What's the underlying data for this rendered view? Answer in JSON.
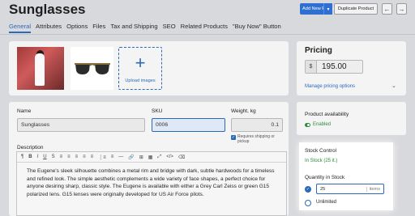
{
  "header": {
    "title": "Sunglasses",
    "add_new_label": "Add New Product",
    "duplicate_label": "Duplicate Product",
    "prev_icon": "arrow-left-icon",
    "next_icon": "arrow-right-icon"
  },
  "tabs": [
    {
      "label": "General",
      "active": true
    },
    {
      "label": "Attributes"
    },
    {
      "label": "Options"
    },
    {
      "label": "Files"
    },
    {
      "label": "Tax and Shipping"
    },
    {
      "label": "SEO"
    },
    {
      "label": "Related Products"
    },
    {
      "label": "\"Buy Now\" Button"
    }
  ],
  "images": {
    "upload_label": "Upload images"
  },
  "fields": {
    "name_label": "Name",
    "name_value": "Sunglasses",
    "sku_label": "SKU",
    "sku_value": "0006",
    "weight_label": "Weight, kg",
    "weight_value": "0.1",
    "shipping_note": "Requires shipping or pickup",
    "description_label": "Description",
    "description_text": "The Eugene's sleek silhouette combines a metal rim and bridge with dark, subtle hardwoods for a timeless and refined look. The simple aesthetic complements a wide variety of face shapes, a perfect choice for anyone desiring sharp, classic style. The Eugene is available with either a Grey Carl Zeiss or green G15 polarized lens. G15 lenses were originally developed for US Air Force pilots."
  },
  "toolbar": {
    "items": [
      "¶",
      "B",
      "I",
      "U",
      "S",
      "≡",
      "≡",
      "≡",
      "≡",
      "≡",
      "⋮≡",
      "≡",
      "—",
      "🔗",
      "⊞",
      "▦",
      "⤢",
      "</>",
      "⌫"
    ]
  },
  "pricing": {
    "title": "Pricing",
    "currency": "$",
    "price": "195.00",
    "manage_link": "Manage pricing options"
  },
  "availability": {
    "title": "Product availability",
    "status": "Enabled"
  },
  "stock": {
    "title": "Stock Control",
    "status": "In Stock (25 it.)",
    "qty_label": "Quantity in Stock",
    "qty_value": "25",
    "qty_unit": "items",
    "unlimited_label": "Unlimited"
  },
  "colors": {
    "accent": "#2a6ab8",
    "success": "#2e8a3e",
    "button_primary": "#2e6fd1"
  }
}
